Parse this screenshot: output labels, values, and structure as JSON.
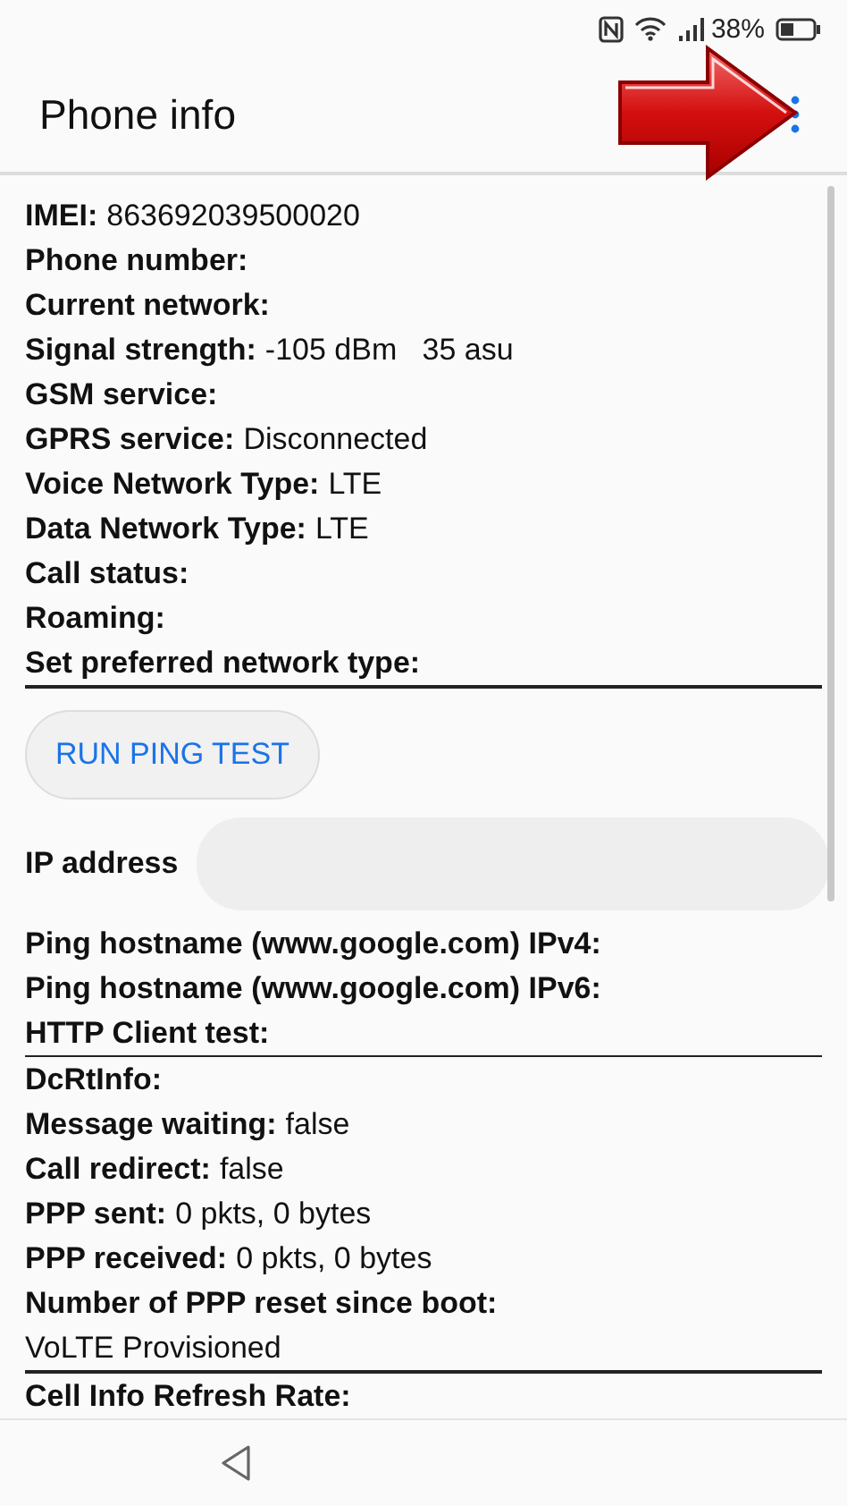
{
  "status_bar": {
    "battery": "38%"
  },
  "app_bar": {
    "title": "Phone info"
  },
  "items": [
    {
      "kind": "row",
      "label": "IMEI:",
      "value": "863692039500020",
      "divider_after": false
    },
    {
      "kind": "row",
      "label": "Phone number:",
      "divider_after": false
    },
    {
      "kind": "row",
      "label": "Current network:",
      "divider_after": false
    },
    {
      "kind": "row",
      "label": "Signal strength:",
      "value": "-105 dBm   35 asu",
      "divider_after": false
    },
    {
      "kind": "row",
      "label": "GSM service:",
      "divider_after": false
    },
    {
      "kind": "row",
      "label": "GPRS service:",
      "value": "Disconnected",
      "divider_after": false
    },
    {
      "kind": "row",
      "label": "Voice Network Type:",
      "value": "LTE",
      "divider_after": false
    },
    {
      "kind": "row",
      "label": "Data Network Type:",
      "value": "LTE",
      "divider_after": false
    },
    {
      "kind": "row",
      "label": "Call status:",
      "divider_after": false
    },
    {
      "kind": "row",
      "label": "Roaming:",
      "divider_after": false
    },
    {
      "kind": "row",
      "label": "Set preferred network type:",
      "divider_after": true
    },
    {
      "kind": "button",
      "label": "RUN PING TEST"
    },
    {
      "kind": "input",
      "label": "IP address"
    },
    {
      "kind": "row",
      "label": "Ping hostname (www.google.com) IPv4:",
      "divider_after": false
    },
    {
      "kind": "row",
      "label": "Ping hostname (www.google.com) IPv6:",
      "divider_after": false
    },
    {
      "kind": "row",
      "label": "HTTP Client test:",
      "divider_after": true
    },
    {
      "kind": "row",
      "label": "DcRtInfo:",
      "divider_after": false
    },
    {
      "kind": "row",
      "label": "Message waiting:",
      "value": "false",
      "divider_after": false
    },
    {
      "kind": "row",
      "label": "Call redirect:",
      "value": "false",
      "divider_after": false
    },
    {
      "kind": "row",
      "label": "PPP sent:",
      "value": "0 pkts, 0 bytes",
      "divider_after": false
    },
    {
      "kind": "row",
      "label": "PPP received:",
      "value": "0 pkts, 0 bytes",
      "divider_after": false
    },
    {
      "kind": "row",
      "label": "Number of PPP reset since boot:",
      "divider_after": false
    },
    {
      "kind": "plain",
      "label": "VoLTE Provisioned",
      "divider_after": true
    },
    {
      "kind": "row",
      "label": "Cell Info Refresh Rate:",
      "divider_after": false
    }
  ]
}
